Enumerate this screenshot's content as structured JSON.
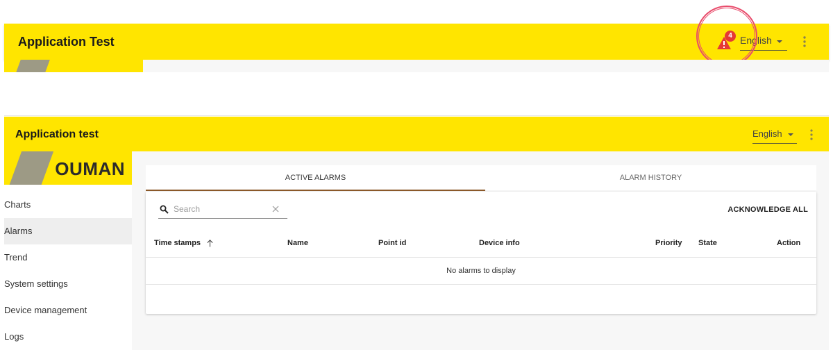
{
  "top_snippet": {
    "app_title": "Application Test",
    "alarm_count": "4",
    "language": "English"
  },
  "header": {
    "app_title": "Application test",
    "language": "English"
  },
  "logo": {
    "text": "OUMAN"
  },
  "sidebar": {
    "items": [
      {
        "label": "Charts"
      },
      {
        "label": "Alarms",
        "active": true
      },
      {
        "label": "Trend"
      },
      {
        "label": "System settings"
      },
      {
        "label": "Device management"
      },
      {
        "label": "Logs"
      }
    ]
  },
  "tabs": [
    {
      "label": "ACTIVE ALARMS",
      "active": true
    },
    {
      "label": "ALARM HISTORY"
    }
  ],
  "toolbar": {
    "search_placeholder": "Search",
    "acknowledge_all": "ACKNOWLEDGE ALL"
  },
  "table": {
    "columns": [
      "Time stamps",
      "Name",
      "Point id",
      "Device info",
      "Priority",
      "State",
      "Action"
    ],
    "empty_message": "No alarms to display"
  },
  "colors": {
    "brand_yellow": "#ffe500",
    "alarm_red": "#e53935",
    "annotation_circle": "#e84a6a",
    "tab_indicator": "#8c5a2a"
  },
  "icons": [
    "warning-icon",
    "chevron-down-icon",
    "more-vert-icon",
    "search-icon",
    "close-icon",
    "arrow-up-icon"
  ]
}
